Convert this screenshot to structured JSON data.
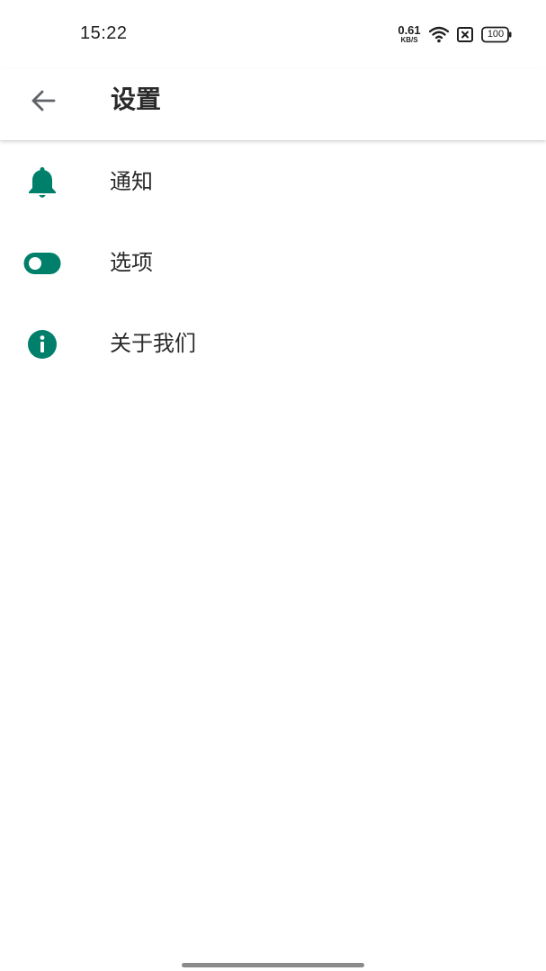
{
  "status_bar": {
    "time": "15:22",
    "net_speed_value": "0.61",
    "net_speed_unit": "KB/S",
    "battery_level": "100",
    "icons": [
      "wifi-icon",
      "no-sim-icon",
      "battery-icon"
    ]
  },
  "app_bar": {
    "back_icon": "arrow-left-icon",
    "title": "设置"
  },
  "settings": {
    "items": [
      {
        "label": "通知",
        "icon": "bell-icon"
      },
      {
        "label": "选项",
        "icon": "toggle-icon"
      },
      {
        "label": "关于我们",
        "icon": "info-icon"
      }
    ]
  },
  "colors": {
    "accent": "#00806A",
    "back_arrow": "#5f6368",
    "text": "#2b2b2b"
  }
}
